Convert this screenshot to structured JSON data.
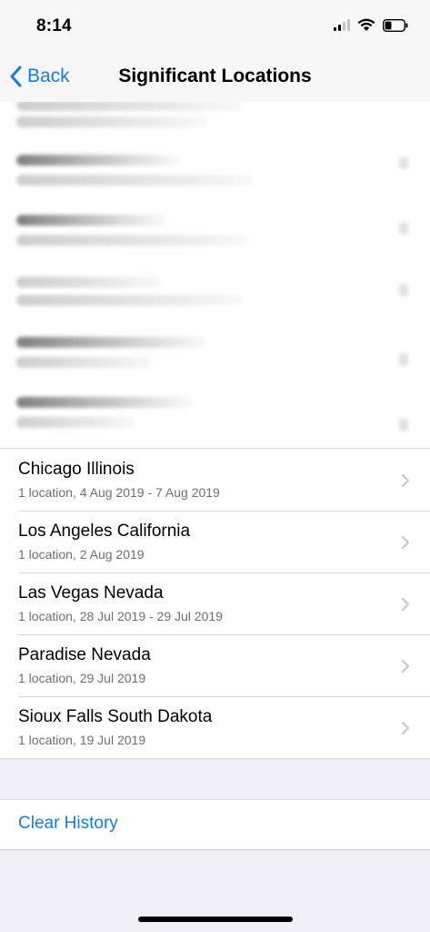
{
  "status_bar": {
    "time": "8:14",
    "battery_level": 0.35
  },
  "nav": {
    "back_label": "Back",
    "title": "Significant Locations"
  },
  "locations": [
    {
      "title": "Chicago Illinois",
      "subtitle": "1 location, 4 Aug 2019 - 7 Aug 2019"
    },
    {
      "title": "Los Angeles California",
      "subtitle": "1 location, 2 Aug 2019"
    },
    {
      "title": "Las Vegas Nevada",
      "subtitle": "1 location, 28 Jul 2019 - 29 Jul 2019"
    },
    {
      "title": "Paradise Nevada",
      "subtitle": "1 location, 29 Jul 2019"
    },
    {
      "title": "Sioux Falls South Dakota",
      "subtitle": "1 location, 19 Jul 2019"
    }
  ],
  "actions": {
    "clear_history": "Clear History"
  },
  "colors": {
    "accent": "#1a7ae0",
    "secondary_text": "#6d6d72",
    "separator": "#d6d6da",
    "background": "#efeff4"
  },
  "icons": {
    "back": "chevron-left-icon",
    "row": "chevron-right-icon",
    "signal": "cellular-signal-icon",
    "wifi": "wifi-icon",
    "battery": "battery-icon"
  }
}
